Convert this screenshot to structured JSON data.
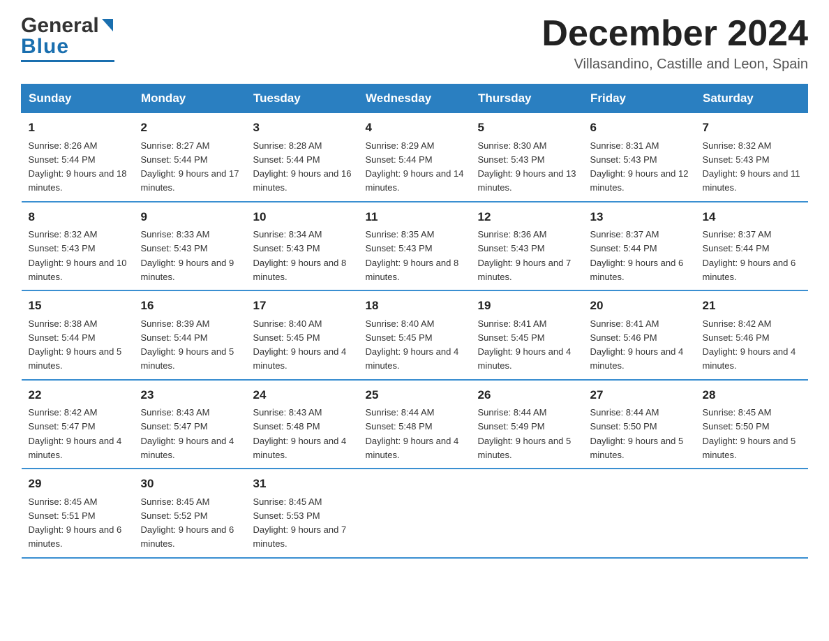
{
  "header": {
    "logo_general": "General",
    "logo_blue": "Blue",
    "month_title": "December 2024",
    "location": "Villasandino, Castille and Leon, Spain"
  },
  "days_of_week": [
    "Sunday",
    "Monday",
    "Tuesday",
    "Wednesday",
    "Thursday",
    "Friday",
    "Saturday"
  ],
  "weeks": [
    [
      {
        "day": "1",
        "sunrise": "8:26 AM",
        "sunset": "5:44 PM",
        "daylight": "9 hours and 18 minutes."
      },
      {
        "day": "2",
        "sunrise": "8:27 AM",
        "sunset": "5:44 PM",
        "daylight": "9 hours and 17 minutes."
      },
      {
        "day": "3",
        "sunrise": "8:28 AM",
        "sunset": "5:44 PM",
        "daylight": "9 hours and 16 minutes."
      },
      {
        "day": "4",
        "sunrise": "8:29 AM",
        "sunset": "5:44 PM",
        "daylight": "9 hours and 14 minutes."
      },
      {
        "day": "5",
        "sunrise": "8:30 AM",
        "sunset": "5:43 PM",
        "daylight": "9 hours and 13 minutes."
      },
      {
        "day": "6",
        "sunrise": "8:31 AM",
        "sunset": "5:43 PM",
        "daylight": "9 hours and 12 minutes."
      },
      {
        "day": "7",
        "sunrise": "8:32 AM",
        "sunset": "5:43 PM",
        "daylight": "9 hours and 11 minutes."
      }
    ],
    [
      {
        "day": "8",
        "sunrise": "8:32 AM",
        "sunset": "5:43 PM",
        "daylight": "9 hours and 10 minutes."
      },
      {
        "day": "9",
        "sunrise": "8:33 AM",
        "sunset": "5:43 PM",
        "daylight": "9 hours and 9 minutes."
      },
      {
        "day": "10",
        "sunrise": "8:34 AM",
        "sunset": "5:43 PM",
        "daylight": "9 hours and 8 minutes."
      },
      {
        "day": "11",
        "sunrise": "8:35 AM",
        "sunset": "5:43 PM",
        "daylight": "9 hours and 8 minutes."
      },
      {
        "day": "12",
        "sunrise": "8:36 AM",
        "sunset": "5:43 PM",
        "daylight": "9 hours and 7 minutes."
      },
      {
        "day": "13",
        "sunrise": "8:37 AM",
        "sunset": "5:44 PM",
        "daylight": "9 hours and 6 minutes."
      },
      {
        "day": "14",
        "sunrise": "8:37 AM",
        "sunset": "5:44 PM",
        "daylight": "9 hours and 6 minutes."
      }
    ],
    [
      {
        "day": "15",
        "sunrise": "8:38 AM",
        "sunset": "5:44 PM",
        "daylight": "9 hours and 5 minutes."
      },
      {
        "day": "16",
        "sunrise": "8:39 AM",
        "sunset": "5:44 PM",
        "daylight": "9 hours and 5 minutes."
      },
      {
        "day": "17",
        "sunrise": "8:40 AM",
        "sunset": "5:45 PM",
        "daylight": "9 hours and 4 minutes."
      },
      {
        "day": "18",
        "sunrise": "8:40 AM",
        "sunset": "5:45 PM",
        "daylight": "9 hours and 4 minutes."
      },
      {
        "day": "19",
        "sunrise": "8:41 AM",
        "sunset": "5:45 PM",
        "daylight": "9 hours and 4 minutes."
      },
      {
        "day": "20",
        "sunrise": "8:41 AM",
        "sunset": "5:46 PM",
        "daylight": "9 hours and 4 minutes."
      },
      {
        "day": "21",
        "sunrise": "8:42 AM",
        "sunset": "5:46 PM",
        "daylight": "9 hours and 4 minutes."
      }
    ],
    [
      {
        "day": "22",
        "sunrise": "8:42 AM",
        "sunset": "5:47 PM",
        "daylight": "9 hours and 4 minutes."
      },
      {
        "day": "23",
        "sunrise": "8:43 AM",
        "sunset": "5:47 PM",
        "daylight": "9 hours and 4 minutes."
      },
      {
        "day": "24",
        "sunrise": "8:43 AM",
        "sunset": "5:48 PM",
        "daylight": "9 hours and 4 minutes."
      },
      {
        "day": "25",
        "sunrise": "8:44 AM",
        "sunset": "5:48 PM",
        "daylight": "9 hours and 4 minutes."
      },
      {
        "day": "26",
        "sunrise": "8:44 AM",
        "sunset": "5:49 PM",
        "daylight": "9 hours and 5 minutes."
      },
      {
        "day": "27",
        "sunrise": "8:44 AM",
        "sunset": "5:50 PM",
        "daylight": "9 hours and 5 minutes."
      },
      {
        "day": "28",
        "sunrise": "8:45 AM",
        "sunset": "5:50 PM",
        "daylight": "9 hours and 5 minutes."
      }
    ],
    [
      {
        "day": "29",
        "sunrise": "8:45 AM",
        "sunset": "5:51 PM",
        "daylight": "9 hours and 6 minutes."
      },
      {
        "day": "30",
        "sunrise": "8:45 AM",
        "sunset": "5:52 PM",
        "daylight": "9 hours and 6 minutes."
      },
      {
        "day": "31",
        "sunrise": "8:45 AM",
        "sunset": "5:53 PM",
        "daylight": "9 hours and 7 minutes."
      },
      null,
      null,
      null,
      null
    ]
  ],
  "labels": {
    "sunrise": "Sunrise:",
    "sunset": "Sunset:",
    "daylight": "Daylight:"
  }
}
